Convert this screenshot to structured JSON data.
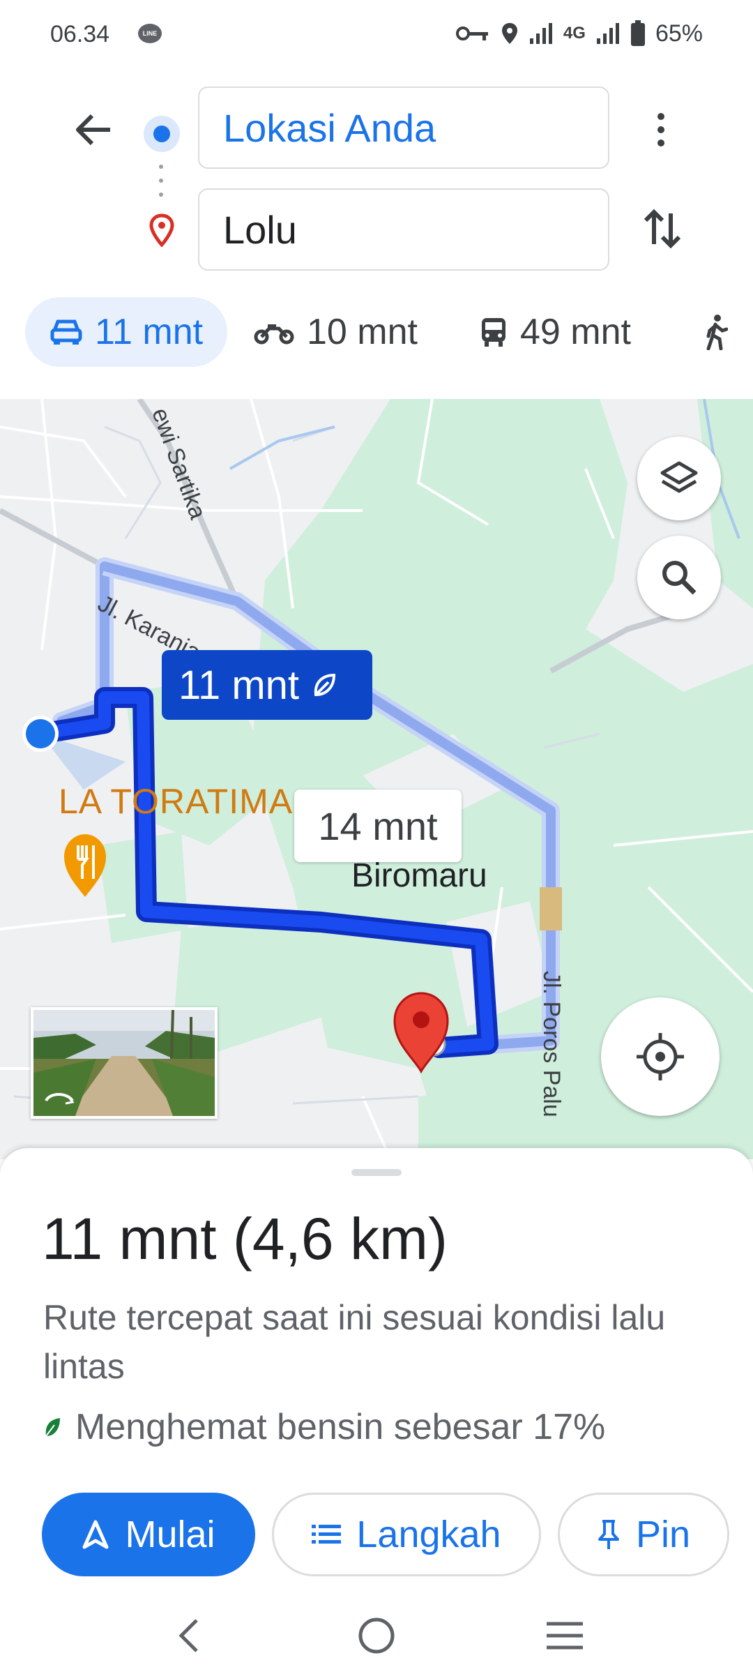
{
  "status_bar": {
    "time": "06.34",
    "line_badge": "LINE",
    "network": "4G",
    "battery": "65%"
  },
  "header": {
    "origin": "Lokasi Anda",
    "destination": "Lolu"
  },
  "modes": [
    {
      "icon": "car-icon",
      "label": "11 mnt",
      "selected": true
    },
    {
      "icon": "motorcycle-icon",
      "label": "10 mnt"
    },
    {
      "icon": "transit-icon",
      "label": "49 mnt"
    },
    {
      "icon": "walk-icon",
      "label": ""
    }
  ],
  "map": {
    "road_labels": [
      "Jl. Karanja L",
      "ewi Sartika",
      "Jl. Poros Palu"
    ],
    "poi_label": "LA TORATIMA",
    "place_label": "Biromaru",
    "route_main_time": "11 mnt",
    "route_alt_time": "14 mnt"
  },
  "sheet": {
    "title": "11 mnt (4,6 km)",
    "description": "Rute tercepat saat ini sesuai kondisi lalu lintas",
    "eco_text": "Menghemat bensin sebesar 17%",
    "buttons": {
      "start": "Mulai",
      "steps": "Langkah",
      "pin": "Pin"
    }
  },
  "colors": {
    "accent": "#1a73e8",
    "route": "#1a3fe0",
    "route_alt": "#8fa9ef",
    "callout": "#0d47c7",
    "park": "#cfeedc",
    "poi": "#d17a10"
  }
}
